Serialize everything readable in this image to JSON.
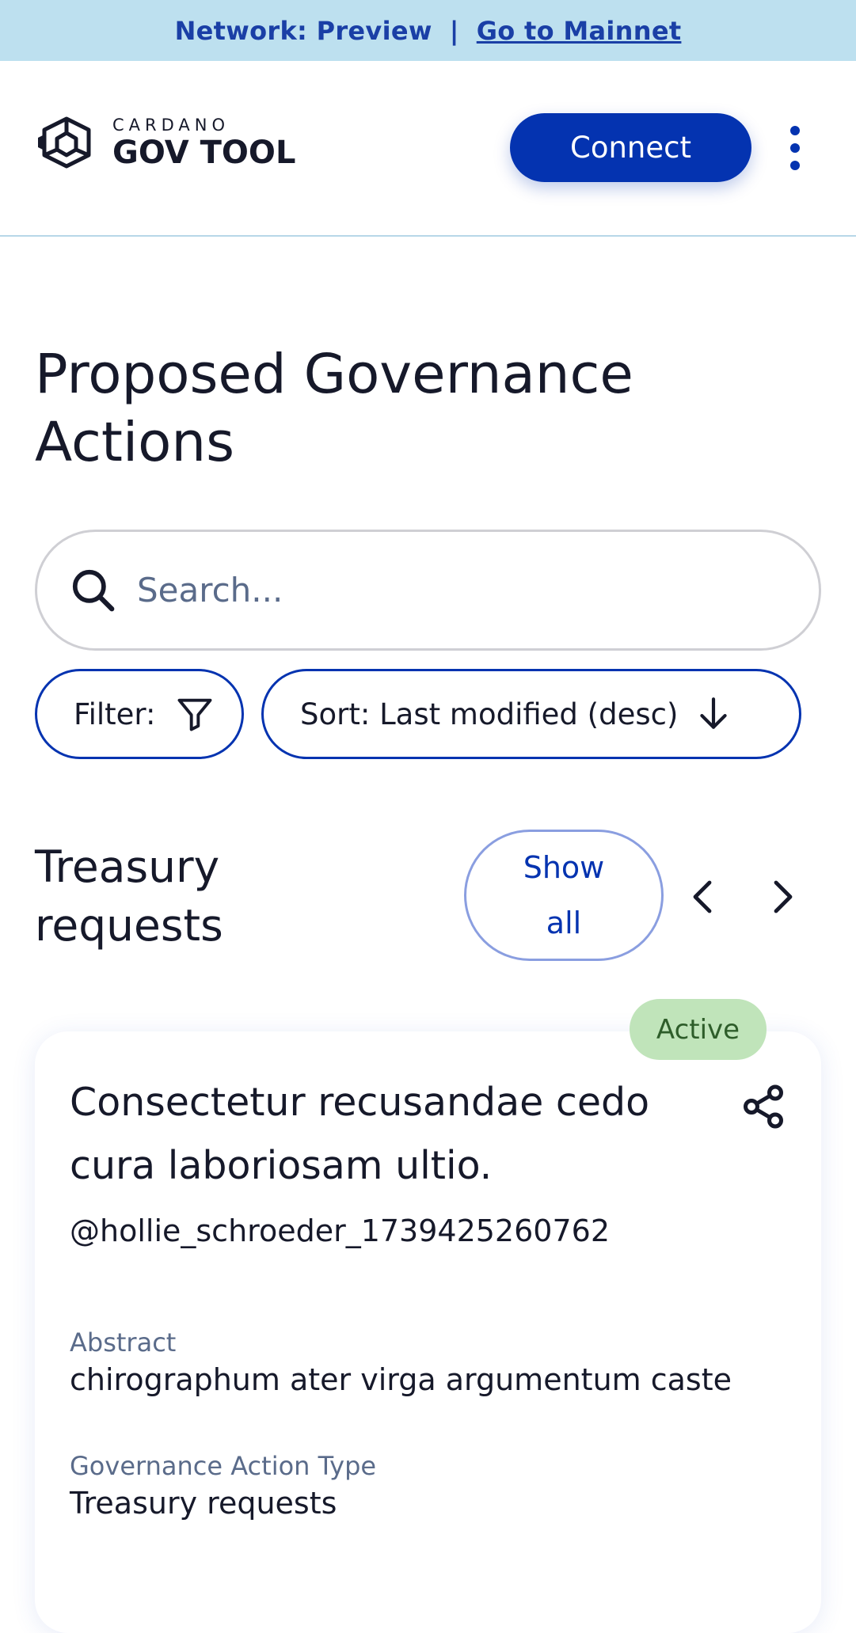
{
  "banner": {
    "network_label": "Network: Preview",
    "separator": "|",
    "mainnet_link": "Go to Mainnet"
  },
  "header": {
    "logo_brand": "CARDANO",
    "logo_product": "GOV TOOL",
    "connect_label": "Connect"
  },
  "page": {
    "title": "Proposed Governance Actions"
  },
  "search": {
    "placeholder": "Search..."
  },
  "controls": {
    "filter_label": "Filter:",
    "sort_label": "Sort: Last modified (desc)"
  },
  "section": {
    "title": "Treasury requests",
    "show_all_label": "Show all"
  },
  "card": {
    "status": "Active",
    "title": "Consectetur recusandae cedo cura laboriosam ultio.",
    "author": "@hollie_schroeder_1739425260762",
    "abstract_label": "Abstract",
    "abstract_value": "chirographum ater virga argumentum caste",
    "type_label": "Governance Action Type",
    "type_value": "Treasury requests"
  },
  "colors": {
    "primary": "#0433b0",
    "banner_bg": "#bde0ef",
    "active_badge_bg": "#c0e4ba",
    "active_badge_text": "#2e5d2a",
    "muted_text": "#5a6b8a"
  },
  "icons": {
    "logo": "cardano-hexagon-logo-icon",
    "menu": "more-vertical-icon",
    "search": "search-icon",
    "filter": "filter-funnel-icon",
    "sort": "arrow-down-icon",
    "prev": "chevron-left-icon",
    "next": "chevron-right-icon",
    "share": "share-icon"
  }
}
